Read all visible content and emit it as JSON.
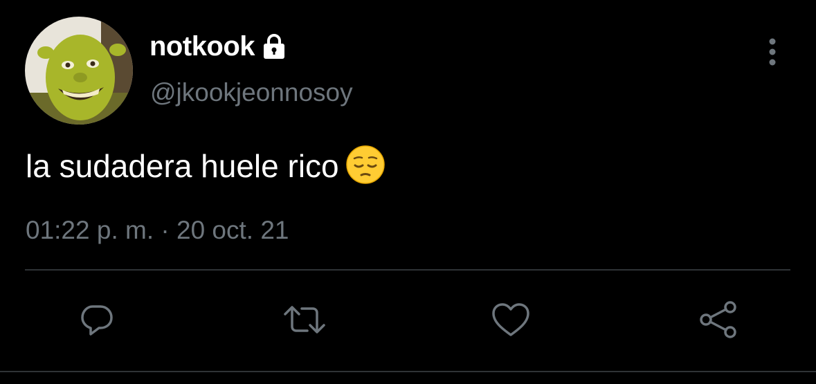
{
  "tweet": {
    "display_name": "notkook",
    "protected_icon": "lock-icon",
    "handle": "@jkookjeonnosoy",
    "text": "la sudadera huele rico",
    "emoji": "pensive-face-emoji",
    "timestamp": "01:22 p. m. · 20 oct. 21",
    "more_icon": "more-vertical-icon"
  },
  "actions": [
    {
      "name": "reply",
      "icon": "reply-icon"
    },
    {
      "name": "retweet",
      "icon": "retweet-icon"
    },
    {
      "name": "like",
      "icon": "heart-icon"
    },
    {
      "name": "share",
      "icon": "share-icon"
    }
  ],
  "colors": {
    "background": "#000000",
    "primary_text": "#ffffff",
    "secondary_text": "#6e767d",
    "divider": "#2f3336",
    "icon": "#6e767d"
  }
}
